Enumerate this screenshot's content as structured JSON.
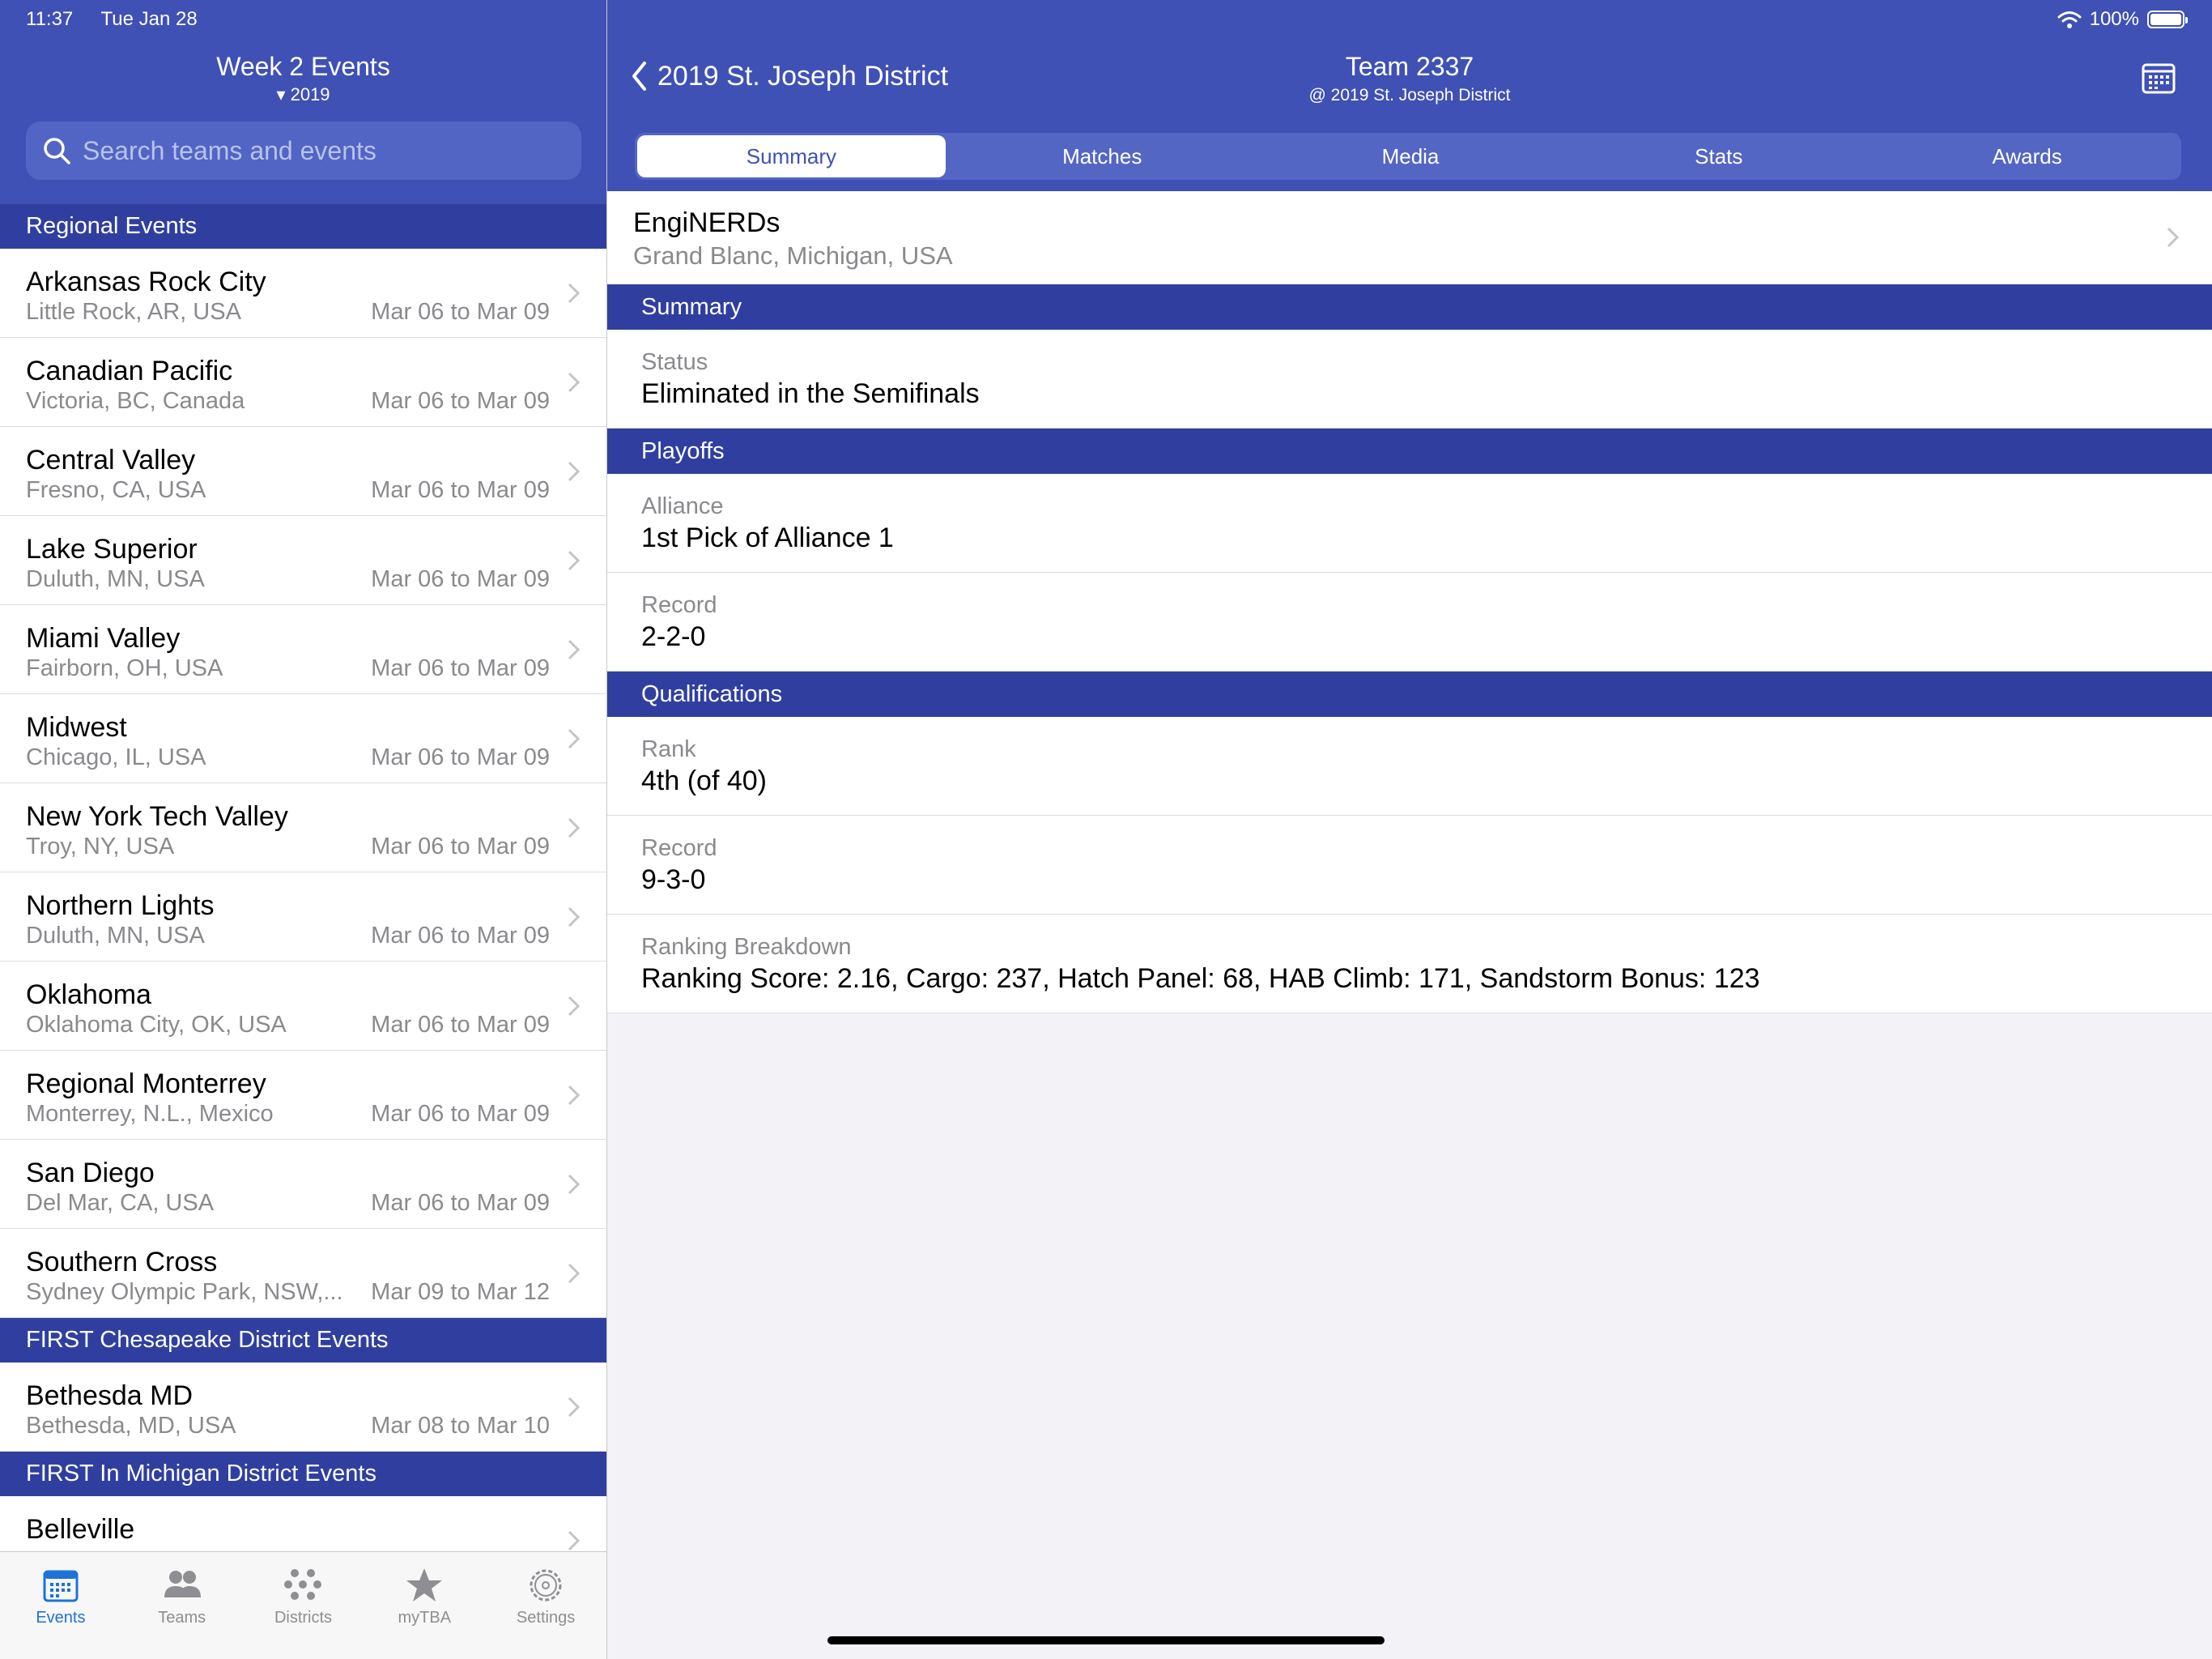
{
  "status_bar": {
    "time": "11:37",
    "date": "Tue Jan 28",
    "battery": "100%"
  },
  "left": {
    "title": "Week 2 Events",
    "subtitle": "▾ 2019",
    "search_placeholder": "Search teams and events",
    "sections": [
      {
        "header": "Regional Events",
        "events": [
          {
            "name": "Arkansas Rock City",
            "location": "Little Rock, AR, USA",
            "dates": "Mar 06 to Mar 09"
          },
          {
            "name": "Canadian Pacific",
            "location": "Victoria, BC, Canada",
            "dates": "Mar 06 to Mar 09"
          },
          {
            "name": "Central Valley",
            "location": "Fresno, CA, USA",
            "dates": "Mar 06 to Mar 09"
          },
          {
            "name": "Lake Superior",
            "location": "Duluth, MN, USA",
            "dates": "Mar 06 to Mar 09"
          },
          {
            "name": "Miami Valley",
            "location": "Fairborn, OH, USA",
            "dates": "Mar 06 to Mar 09"
          },
          {
            "name": "Midwest",
            "location": "Chicago, IL, USA",
            "dates": "Mar 06 to Mar 09"
          },
          {
            "name": "New York Tech Valley",
            "location": "Troy, NY, USA",
            "dates": "Mar 06 to Mar 09"
          },
          {
            "name": "Northern Lights",
            "location": "Duluth, MN, USA",
            "dates": "Mar 06 to Mar 09"
          },
          {
            "name": "Oklahoma",
            "location": "Oklahoma City, OK, USA",
            "dates": "Mar 06 to Mar 09"
          },
          {
            "name": "Regional Monterrey",
            "location": "Monterrey, N.L., Mexico",
            "dates": "Mar 06 to Mar 09"
          },
          {
            "name": "San Diego",
            "location": "Del Mar, CA, USA",
            "dates": "Mar 06 to Mar 09"
          },
          {
            "name": "Southern Cross",
            "location": "Sydney Olympic Park, NSW,...",
            "dates": "Mar 09 to Mar 12"
          }
        ]
      },
      {
        "header": "FIRST Chesapeake District Events",
        "events": [
          {
            "name": "Bethesda MD",
            "location": "Bethesda, MD, USA",
            "dates": "Mar 08 to Mar 10"
          }
        ]
      },
      {
        "header": "FIRST In Michigan District Events",
        "events": [
          {
            "name": "Belleville",
            "location": "",
            "dates": ""
          }
        ]
      }
    ],
    "tabs": [
      "Events",
      "Teams",
      "Districts",
      "myTBA",
      "Settings"
    ]
  },
  "right": {
    "back_label": "2019 St. Joseph District",
    "title": "Team 2337",
    "subtitle": "@ 2019 St. Joseph District",
    "segments": [
      "Summary",
      "Matches",
      "Media",
      "Stats",
      "Awards"
    ],
    "team": {
      "nickname": "EngiNERDs",
      "location": "Grand Blanc, Michigan, USA"
    },
    "sections": [
      {
        "header": "Summary",
        "rows": [
          {
            "label": "Status",
            "value": "Eliminated in the Semifinals"
          }
        ]
      },
      {
        "header": "Playoffs",
        "rows": [
          {
            "label": "Alliance",
            "value": "1st Pick of Alliance 1"
          },
          {
            "label": "Record",
            "value": "2-2-0"
          }
        ]
      },
      {
        "header": "Qualifications",
        "rows": [
          {
            "label": "Rank",
            "value": "4th (of 40)"
          },
          {
            "label": "Record",
            "value": "9-3-0"
          },
          {
            "label": "Ranking Breakdown",
            "value": "Ranking Score: 2.16, Cargo: 237, Hatch Panel: 68, HAB Climb: 171, Sandstorm Bonus: 123"
          }
        ]
      }
    ]
  },
  "colors": {
    "primary": "#3f51b5",
    "primary_dark": "#303f9f",
    "tab_active": "#1e72d8"
  }
}
